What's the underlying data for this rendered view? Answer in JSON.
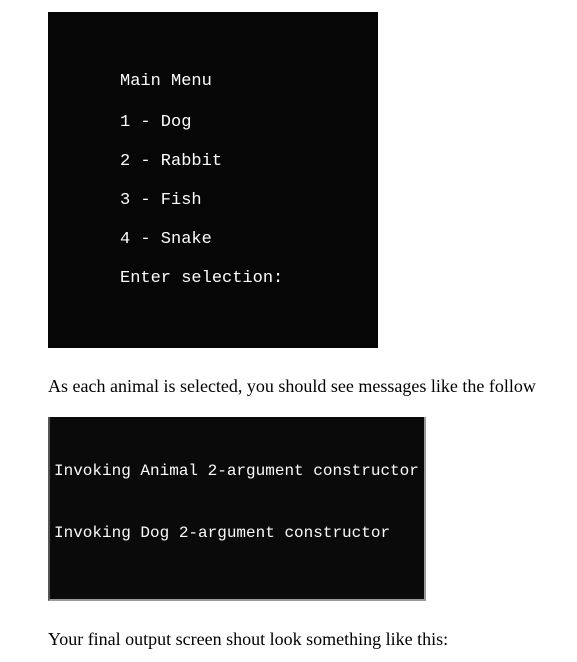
{
  "terminal1": {
    "title": "Main Menu",
    "items": [
      "1 - Dog",
      "2 - Rabbit",
      "3 - Fish",
      "4 - Snake"
    ],
    "prompt": "Enter selection:"
  },
  "paragraph1": "As each animal is selected, you should see messages like the follow",
  "terminal2": {
    "lines": [
      "Invoking Animal 2-argument constructor",
      "Invoking Dog 2-argument constructor"
    ]
  },
  "paragraph2": "Your final output screen shout look something like this:"
}
